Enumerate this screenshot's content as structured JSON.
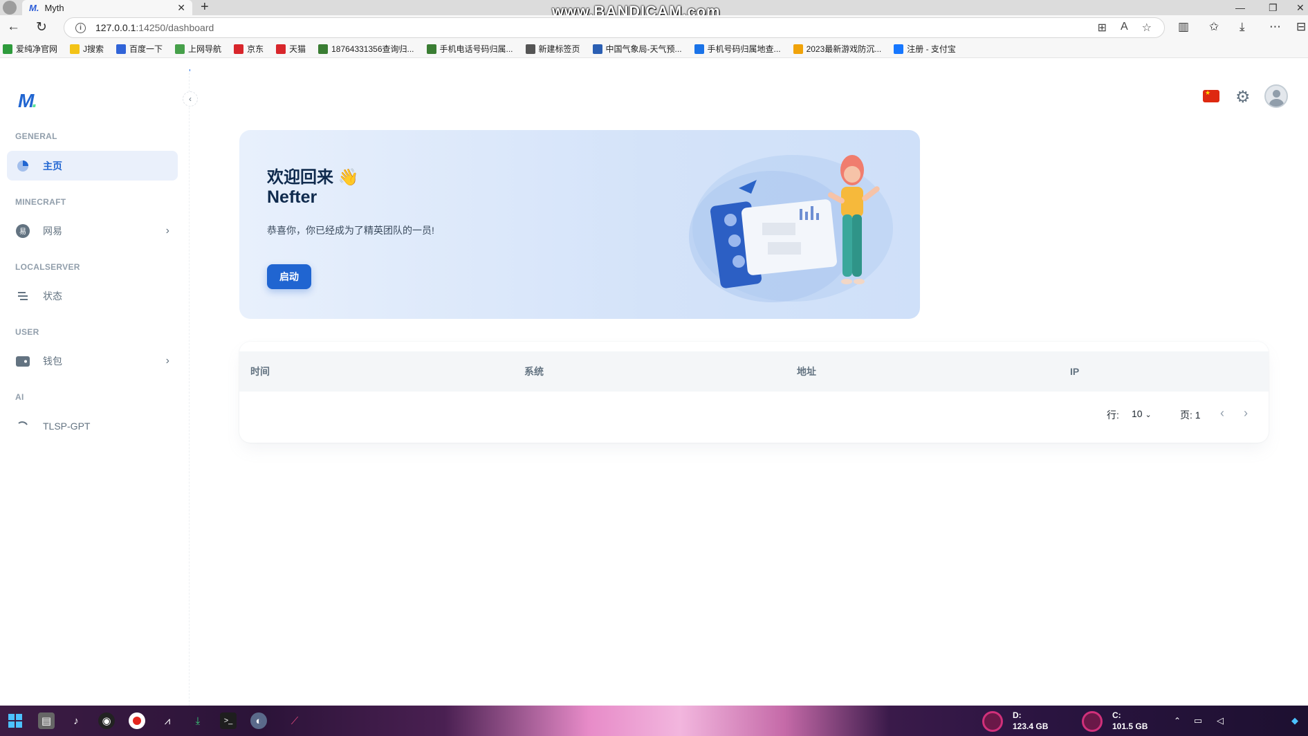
{
  "browser": {
    "tab_title": "Myth",
    "tab_logo": "M.",
    "tab_close": "✕",
    "new_tab": "+",
    "watermark": "www.BANDICAM.com",
    "url_host": "127.0.0.1",
    "url_path": ":14250/dashboard",
    "bookmarks": [
      {
        "label": "爱纯净官网",
        "color": "#2e9b3c"
      },
      {
        "label": "J搜索",
        "color": "#f3c316"
      },
      {
        "label": "百度一下",
        "color": "#3164d8"
      },
      {
        "label": "上网导航",
        "color": "#46a04a"
      },
      {
        "label": "京东",
        "color": "#d8262b"
      },
      {
        "label": "天猫",
        "color": "#d8262b"
      },
      {
        "label": "18764331356查询归...",
        "color": "#3a7d33"
      },
      {
        "label": "手机电话号码归属...",
        "color": "#3a7d33"
      },
      {
        "label": "新建标签页",
        "color": "#555555"
      },
      {
        "label": "中国气象局-天气预...",
        "color": "#2b5fb3"
      },
      {
        "label": "手机号码归属地查...",
        "color": "#1a73e8"
      },
      {
        "label": "2023最新游戏防沉...",
        "color": "#f0a30a"
      },
      {
        "label": "注册 - 支付宝",
        "color": "#1677ff"
      }
    ]
  },
  "app": {
    "logo": "M",
    "logo_dot": ".",
    "collapse_icon": "‹",
    "sections": {
      "general": "GENERAL",
      "minecraft": "MINECRAFT",
      "localserver": "LOCALSERVER",
      "user": "USER",
      "ai": "AI"
    },
    "nav": {
      "home": "主页",
      "netease": "网易",
      "status": "状态",
      "wallet": "钱包",
      "gpt": "TLSP-GPT"
    },
    "chevron": "›",
    "welcome": {
      "title": "欢迎回来 👋",
      "name": "Nefter",
      "subtitle": "恭喜你，你已经成为了精英团队的一员!",
      "button": "启动"
    },
    "table": {
      "headers": [
        "时间",
        "系统",
        "地址",
        "IP"
      ],
      "rows": [],
      "rows_label": "行:",
      "rows_value": "10",
      "page_label": "页: 1"
    }
  },
  "taskbar": {
    "drive_d_label": "D:",
    "drive_d_size": "123.4 GB",
    "drive_c_label": "C:",
    "drive_c_size": "101.5 GB"
  }
}
